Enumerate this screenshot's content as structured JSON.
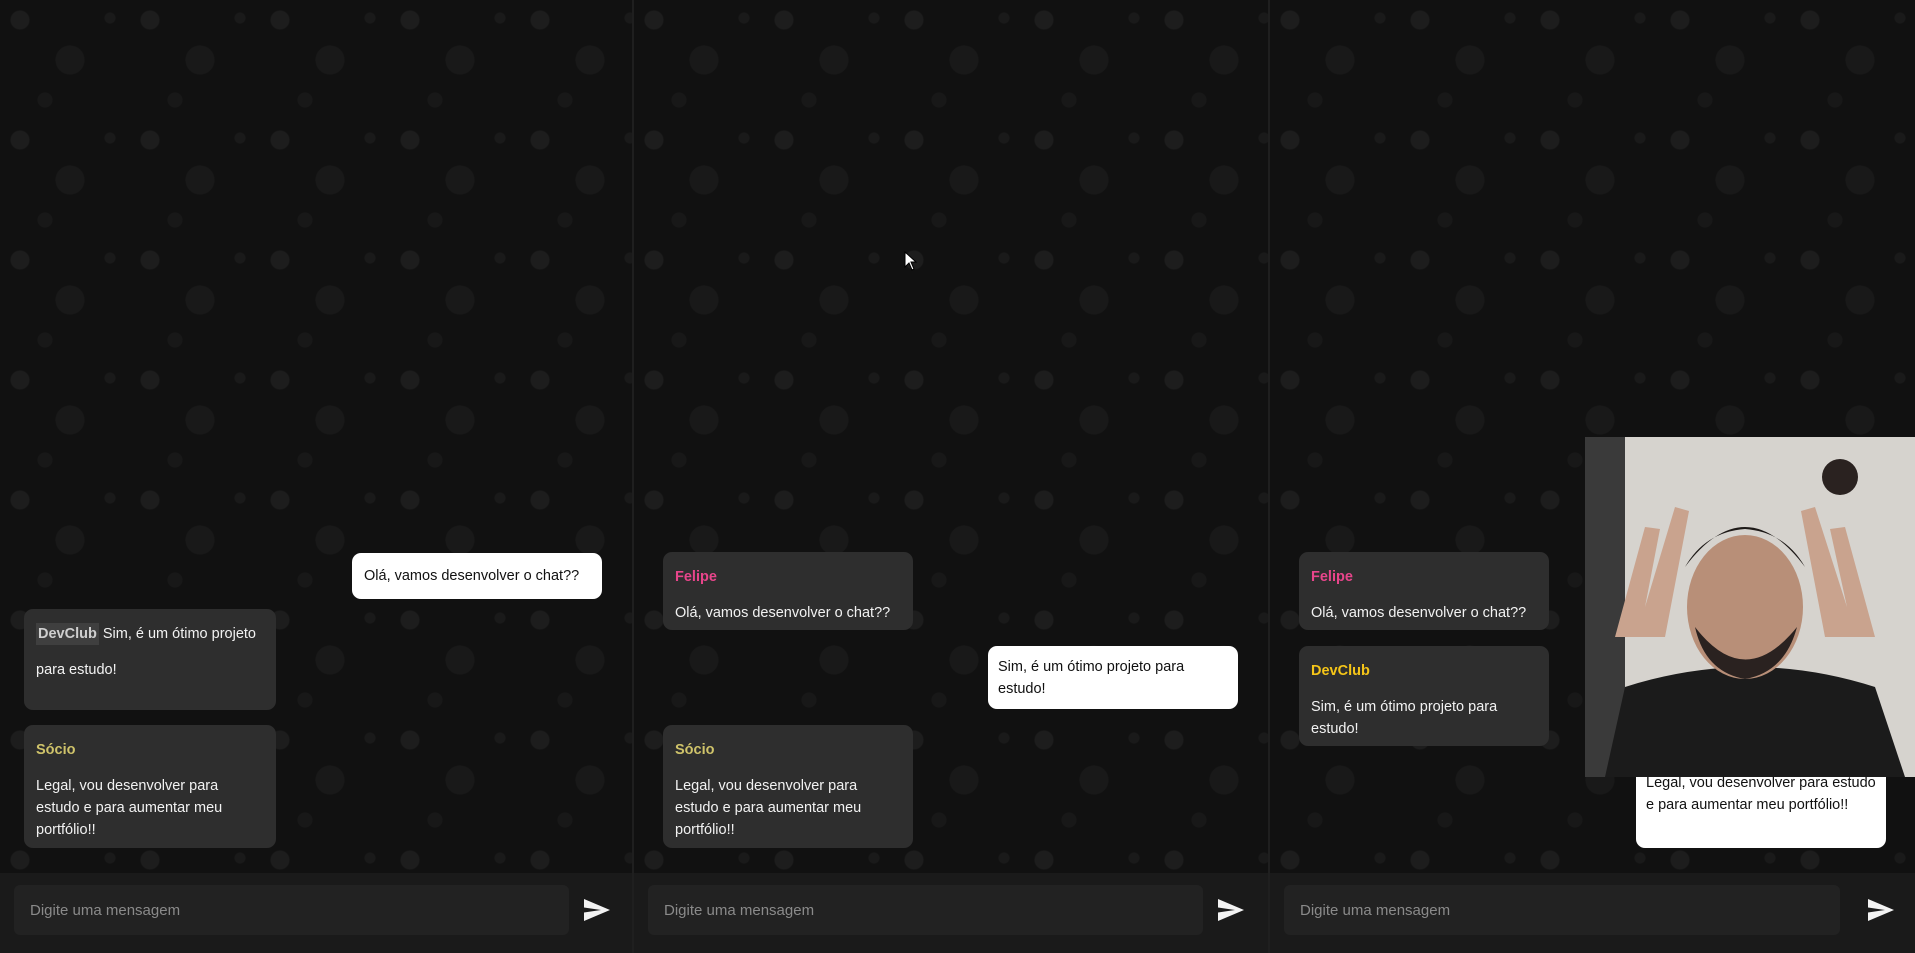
{
  "panels": [
    {
      "messages": [
        {
          "sender": "",
          "text": "Olá, vamos desenvolver o chat??",
          "direction": "out"
        },
        {
          "sender": "DevClub",
          "text": "Sim, é um ótimo projeto para estudo!",
          "direction": "in"
        },
        {
          "sender": "Sócio",
          "text": "Legal, vou desenvolver para estudo e para aumentar meu portfólio!!",
          "direction": "in"
        }
      ],
      "input_placeholder": "Digite uma mensagem"
    },
    {
      "messages": [
        {
          "sender": "Felipe",
          "text": "Olá, vamos desenvolver o chat??",
          "direction": "in"
        },
        {
          "sender": "",
          "text": "Sim, é um ótimo projeto para estudo!",
          "direction": "out"
        },
        {
          "sender": "Sócio",
          "text": "Legal, vou desenvolver para estudo e para aumentar meu portfólio!!",
          "direction": "in"
        }
      ],
      "input_placeholder": "Digite uma mensagem"
    },
    {
      "messages": [
        {
          "sender": "Felipe",
          "text": "Olá, vamos desenvolver o chat??",
          "direction": "in"
        },
        {
          "sender": "DevClub",
          "text": "Sim, é um ótimo projeto para estudo!",
          "direction": "in"
        },
        {
          "sender": "",
          "text": "Legal, vou desenvolver para estudo e para aumentar meu portfólio!!",
          "direction": "out"
        }
      ],
      "input_placeholder": "Digite uma mensagem"
    }
  ],
  "icons": {
    "send": "send-arrow-icon",
    "cursor": "mouse-pointer-icon",
    "webcam": "webcam-overlay"
  },
  "colors": {
    "background": "#111111",
    "bubble_incoming": "#2e2e2e",
    "bubble_outgoing": "#ffffff",
    "sender_devclub": "#f5c518",
    "sender_felipe": "#e8458b",
    "sender_socio": "#cfc36a"
  }
}
